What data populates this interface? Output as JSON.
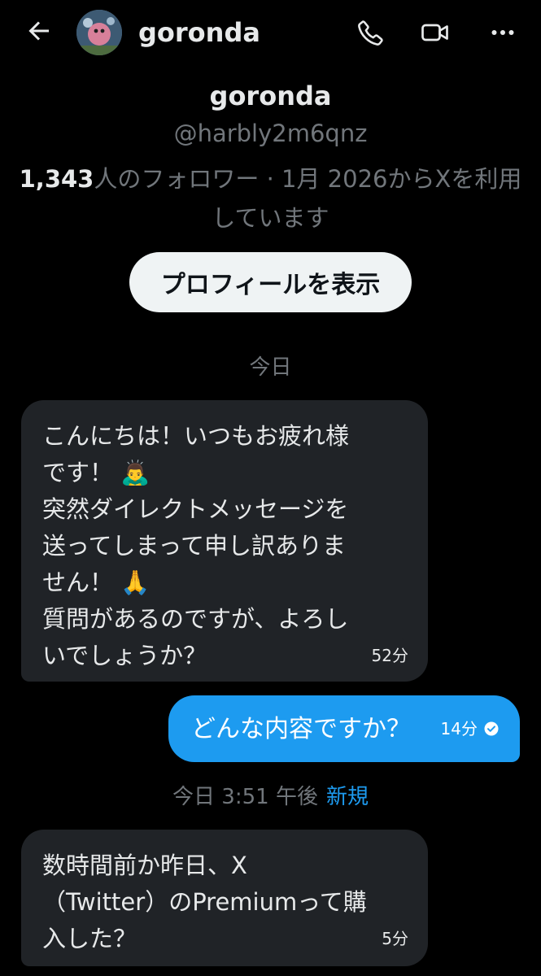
{
  "header": {
    "name": "goronda",
    "back_icon": "arrow-left-icon",
    "call_icon": "phone-icon",
    "video_icon": "video-camera-icon",
    "more_icon": "more-horizontal-icon"
  },
  "profile": {
    "name": "goronda",
    "handle": "@harbly2m6qnz",
    "follower_count": "1,343",
    "meta_line1_rest": "人のフォロワー · 1月 2026からXを利用",
    "meta_line2": "しています",
    "view_profile_label": "プロフィールを表示"
  },
  "conversation": {
    "date_separator": "今日",
    "messages": [
      {
        "direction": "in",
        "text": "こんにちは！いつもお疲れ様\nです！ 🙇‍♂️\n突然ダイレクトメッセージを\n送ってしまって申し訳ありま\nせん！ 🙏\n質問があるのですが、よろし\nいでしょうか？",
        "time": "52分"
      },
      {
        "direction": "out",
        "text": "どんな内容ですか？",
        "time": "14分",
        "status_icon": "read-check-icon"
      },
      {
        "direction": "in",
        "text": "数時間前か昨日、X\n（Twitter）のPremiumって購\n入した？",
        "time": "5分"
      }
    ],
    "new_separator_time": "今日 3:51 午後",
    "new_separator_label": "新規"
  },
  "colors": {
    "background": "#000000",
    "incoming_bubble": "#202327",
    "outgoing_bubble": "#1d9bf0",
    "secondary_text": "#71767b",
    "accent": "#1d9bf0"
  }
}
